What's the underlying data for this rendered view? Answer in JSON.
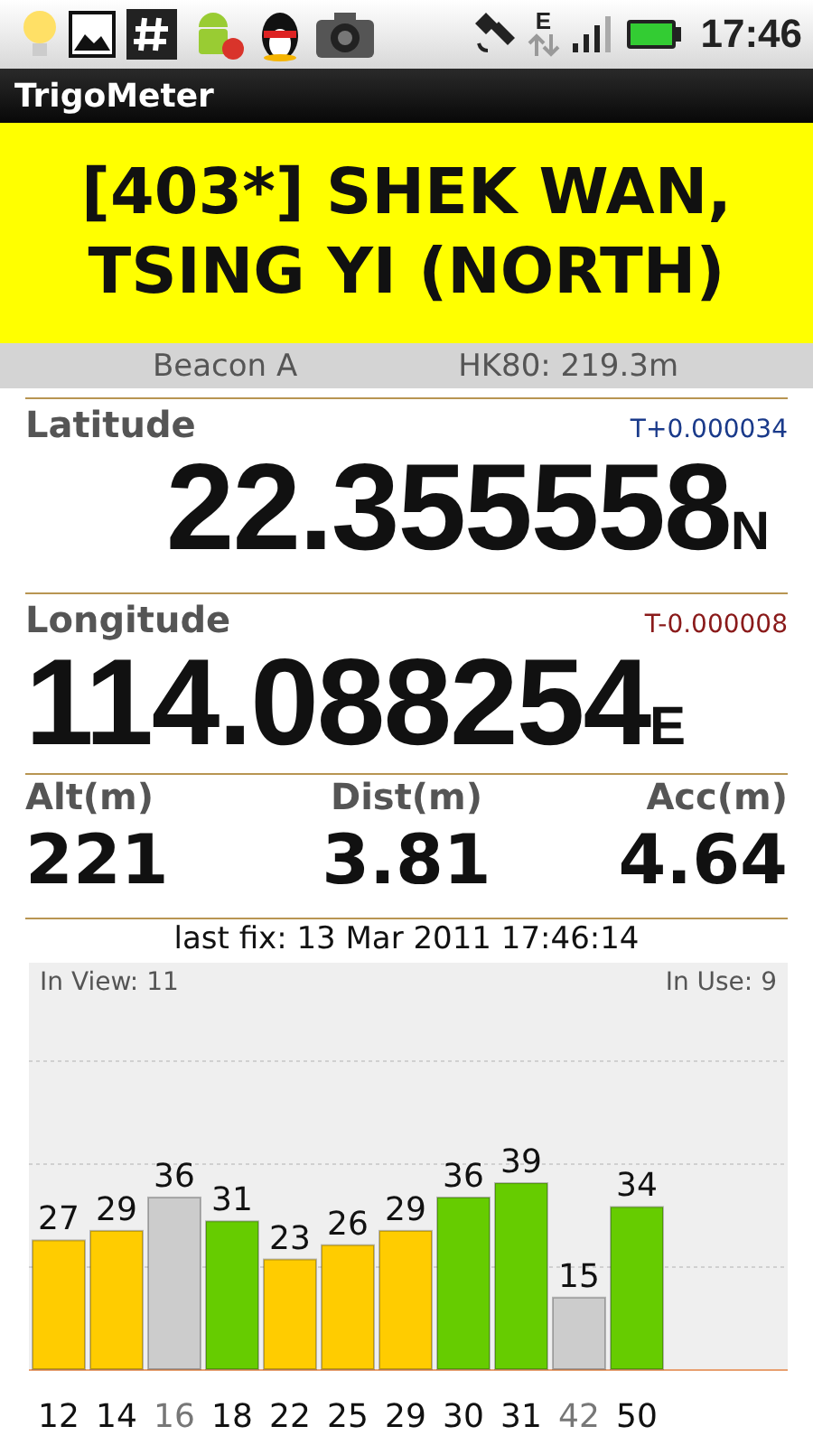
{
  "status_bar": {
    "network": "E",
    "time": "17:46"
  },
  "app_bar": {
    "title": "TrigoMeter"
  },
  "station": {
    "name": "[403*] SHEK WAN, TSING YI (NORTH)"
  },
  "info": {
    "beacon": "Beacon A",
    "height": "HK80: 219.3m"
  },
  "coordinates": [
    {
      "label": "Latitude",
      "offset": "T+0.000034",
      "color": "#1a3a8a",
      "value": "22.355558",
      "hemisphere": "N"
    },
    {
      "label": "Longitude",
      "offset": "T-0.000008",
      "color": "#8a1a1a",
      "value": "114.088254",
      "hemisphere": "E"
    }
  ],
  "stats": [
    {
      "label": "Alt(m)",
      "value": "221"
    },
    {
      "label": "Dist(m)",
      "value": "3.81"
    },
    {
      "label": "Acc(m)",
      "value": "4.64"
    }
  ],
  "last_fix": "last fix: 13 Mar 2011 17:46:14",
  "satellites": {
    "in_view": "In View: 11",
    "in_use": "In Use: 9",
    "bars": [
      {
        "color": "#ffcc00",
        "dimmed": false
      },
      {
        "color": "#ffcc00",
        "dimmed": false
      },
      {
        "color": "#cccccc",
        "dimmed": true
      },
      {
        "color": "#66cc00",
        "dimmed": false
      },
      {
        "color": "#ffcc00",
        "dimmed": false
      },
      {
        "color": "#ffcc00",
        "dimmed": false
      },
      {
        "color": "#ffcc00",
        "dimmed": false
      },
      {
        "color": "#66cc00",
        "dimmed": false
      },
      {
        "color": "#66cc00",
        "dimmed": false
      },
      {
        "color": "#cccccc",
        "dimmed": true
      },
      {
        "color": "#66cc00",
        "dimmed": false
      }
    ],
    "chart_data": {
      "type": "bar",
      "categories": [
        "12",
        "14",
        "16",
        "18",
        "22",
        "25",
        "29",
        "30",
        "31",
        "42",
        "50"
      ],
      "data_labels": true,
      "values": [
        27,
        29,
        36,
        31,
        23,
        26,
        29,
        36,
        39,
        15,
        34
      ]
    }
  }
}
